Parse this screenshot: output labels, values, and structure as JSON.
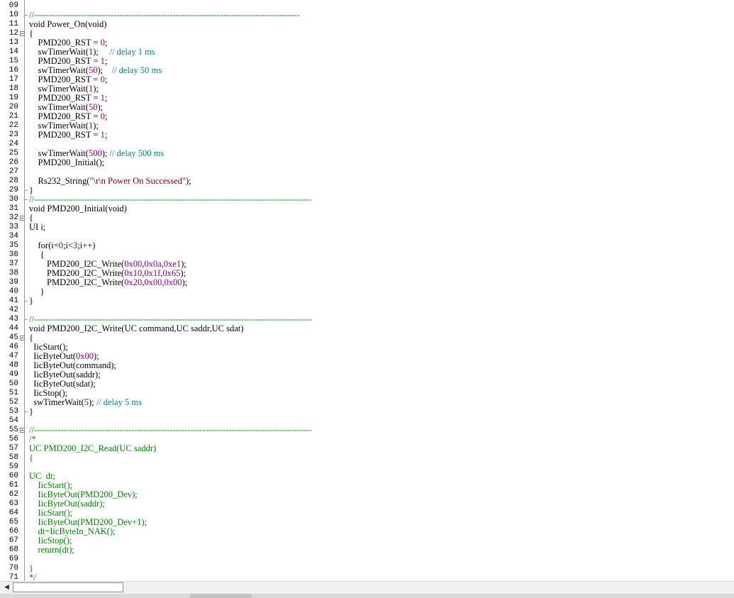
{
  "editor": {
    "lines": [
      {
        "num": "09",
        "text": ""
      },
      {
        "num": "10",
        "fold": "end",
        "text": "//------------------------------------------------------------------------------------------",
        "cls": "c"
      },
      {
        "num": "11",
        "text": "void Power_On(void)"
      },
      {
        "num": "12",
        "fold": "start",
        "text": "{"
      },
      {
        "num": "13",
        "text": "    PMD200_RST = §n0§;"
      },
      {
        "num": "14",
        "text": "    swTimerWait(§n1§);     §k// delay 1 ms§"
      },
      {
        "num": "15",
        "text": "    PMD200_RST = §n1§;"
      },
      {
        "num": "16",
        "text": "    swTimerWait(§n50§);    §k// delay 50 ms§"
      },
      {
        "num": "17",
        "text": "    PMD200_RST = §n0§;"
      },
      {
        "num": "18",
        "text": "    swTimerWait(§n1§);"
      },
      {
        "num": "19",
        "text": "    PMD200_RST = §n1§;"
      },
      {
        "num": "20",
        "text": "    swTimerWait(§n50§);"
      },
      {
        "num": "21",
        "text": "    PMD200_RST = §n0§;"
      },
      {
        "num": "22",
        "text": "    swTimerWait(§n1§);"
      },
      {
        "num": "23",
        "text": "    PMD200_RST = §n1§;"
      },
      {
        "num": "24",
        "text": ""
      },
      {
        "num": "25",
        "text": "    swTimerWait(§n500§); §k// delay 500 ms§"
      },
      {
        "num": "26",
        "text": "    PMD200_Initial();"
      },
      {
        "num": "27",
        "text": ""
      },
      {
        "num": "28",
        "text": "    Rs232_String(§s\"\\r\\n Power On Successed\"§);"
      },
      {
        "num": "29",
        "fold": "end",
        "text": "}"
      },
      {
        "num": "30",
        "fold": "end",
        "text": "//----------------------------------------------------------------------------------------------",
        "cls": "c"
      },
      {
        "num": "31",
        "text": "void PMD200_Initial(void)"
      },
      {
        "num": "32",
        "fold": "start",
        "text": "{"
      },
      {
        "num": "33",
        "text": "UI i;"
      },
      {
        "num": "34",
        "text": ""
      },
      {
        "num": "35",
        "text": "    for(i=§n0§;i<§n3§;i++)"
      },
      {
        "num": "36",
        "text": "     {"
      },
      {
        "num": "37",
        "text": "        PMD200_I2C_Write(§n0x00§,§n0x0a§,§n0xe1§);"
      },
      {
        "num": "38",
        "text": "        PMD200_I2C_Write(§n0x10§,§n0x1f§,§n0x65§);"
      },
      {
        "num": "39",
        "text": "        PMD200_I2C_Write(§n0x20§,§n0x00§,§n0x00§);"
      },
      {
        "num": "40",
        "text": "     }"
      },
      {
        "num": "41",
        "fold": "end",
        "text": "}"
      },
      {
        "num": "42",
        "text": ""
      },
      {
        "num": "43",
        "fold": "end",
        "text": "//----------------------------------------------------------------------------------------------",
        "cls": "c"
      },
      {
        "num": "44",
        "text": "void PMD200_I2C_Write(UC command,UC saddr,UC sdat)"
      },
      {
        "num": "45",
        "fold": "start",
        "text": "{"
      },
      {
        "num": "46",
        "text": "  IicStart();"
      },
      {
        "num": "47",
        "text": "  IicByteOut(§n0x00§);"
      },
      {
        "num": "48",
        "text": "  IicByteOut(command);"
      },
      {
        "num": "49",
        "text": "  IicByteOut(saddr);"
      },
      {
        "num": "50",
        "text": "  IicByteOut(sdat);"
      },
      {
        "num": "51",
        "text": "  IicStop();"
      },
      {
        "num": "52",
        "text": "  swTimerWait(§n5§); §k// delay 5 ms§"
      },
      {
        "num": "53",
        "fold": "end",
        "text": "}"
      },
      {
        "num": "54",
        "text": ""
      },
      {
        "num": "55",
        "fold": "start",
        "text": "//----------------------------------------------------------------------------------------------",
        "cls": "c"
      },
      {
        "num": "56",
        "text": "/*",
        "cls": "c"
      },
      {
        "num": "57",
        "text": "UC PMD200_I2C_Read(UC saddr)",
        "cls": "c"
      },
      {
        "num": "58",
        "text": "{",
        "cls": "c"
      },
      {
        "num": "59",
        "text": "",
        "cls": "c"
      },
      {
        "num": "60",
        "text": "UC  dt;",
        "cls": "c"
      },
      {
        "num": "61",
        "text": "    IicStart();",
        "cls": "c"
      },
      {
        "num": "62",
        "text": "    IicByteOut(PMD200_Dev);",
        "cls": "c"
      },
      {
        "num": "63",
        "text": "    IicByteOut(saddr);",
        "cls": "c"
      },
      {
        "num": "64",
        "text": "    IicStart();",
        "cls": "c"
      },
      {
        "num": "65",
        "text": "    IicByteOut(PMD200_Dev+1);",
        "cls": "c"
      },
      {
        "num": "66",
        "text": "    dt=IicByteIn_NAK();",
        "cls": "c"
      },
      {
        "num": "67",
        "text": "    IicStop();",
        "cls": "c"
      },
      {
        "num": "68",
        "text": "    return(dt);",
        "cls": "c"
      },
      {
        "num": "69",
        "text": "",
        "cls": "c"
      },
      {
        "num": "70",
        "text": "}",
        "cls": "c"
      },
      {
        "num": "71",
        "text": "*/",
        "cls": "c"
      }
    ]
  },
  "scrollbar": {
    "left_arrow_icon": "arrow-left-icon",
    "left_arrow_glyph": "◀"
  },
  "colors": {
    "comment": "#008000",
    "number": "#800080",
    "string": "#800000",
    "inline_comment": "#008080"
  }
}
